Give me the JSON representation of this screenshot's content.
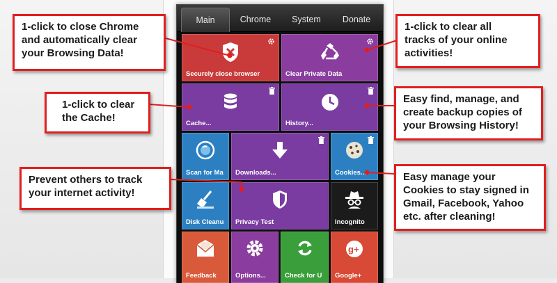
{
  "tabs": [
    "Main",
    "Chrome",
    "System",
    "Donate"
  ],
  "tiles": {
    "close_browser": "Securely close browser",
    "clear_private": "Clear Private Data",
    "cache": "Cache...",
    "history": "History...",
    "scan": "Scan for Ma",
    "downloads": "Downloads...",
    "cookies": "Cookies...",
    "disk": "Disk Cleanu",
    "privacy": "Privacy Test",
    "incognito": "Incognito",
    "feedback": "Feedback",
    "options": "Options...",
    "check": "Check for U",
    "google": "Google+"
  },
  "callouts": {
    "close": [
      "1-click to close Chrome",
      "and automatically clear",
      "your Browsing Data!"
    ],
    "clear_tracks": [
      "1-click to clear all",
      "tracks of your online",
      "activities!"
    ],
    "cache": [
      "1-click to clear",
      "the Cache!"
    ],
    "history": [
      "Easy find, manage, and",
      "create backup copies of",
      "your Browsing History!"
    ],
    "track": [
      "Prevent others to track",
      "your internet activity!"
    ],
    "cookies": [
      "Easy manage your",
      "Cookies to stay signed in",
      "Gmail, Facebook, Yahoo",
      "etc. after cleaning!"
    ]
  },
  "colors": {
    "red": "#c93a3a",
    "purple": "#8a3d9e",
    "purple_dark": "#6c3a92",
    "blue": "#2c80c2",
    "green": "#3a9f3a",
    "orange": "#d85a3a",
    "gplus": "#d84a35",
    "callout_border": "#e01f1f"
  },
  "icons": {
    "close": "shield-x-icon",
    "clear": "recycle-icon",
    "cache": "database-icon",
    "history": "clock-icon",
    "scan": "magnifier-icon",
    "downloads": "download-arrow-icon",
    "cookies": "cookie-icon",
    "disk": "broom-icon",
    "privacy": "shield-icon",
    "incognito": "spy-icon",
    "feedback": "mail-icon",
    "options": "gear-icon",
    "check": "refresh-icon",
    "google": "google-plus-icon"
  }
}
